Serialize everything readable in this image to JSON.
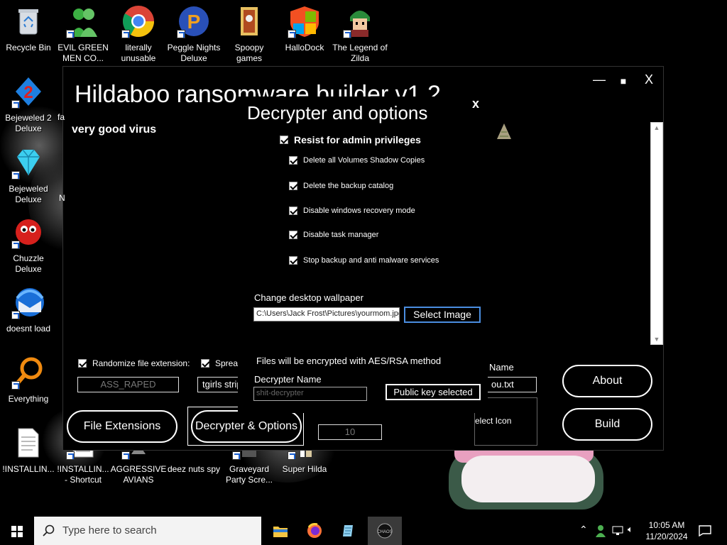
{
  "desktop": {
    "icons": [
      {
        "label": "Recycle Bin",
        "icon": "recycle-bin-icon"
      },
      {
        "label": "EVIL GREEN MEN CO...",
        "icon": "green-men-icon"
      },
      {
        "label": "literally unusable",
        "icon": "chrome-icon"
      },
      {
        "label": "Peggle Nights Deluxe",
        "icon": "peggle-icon"
      },
      {
        "label": "Spoopy games",
        "icon": "folder-icon"
      },
      {
        "label": "HalloDock",
        "icon": "windows-logo-icon"
      },
      {
        "label": "The Legend of Zilda",
        "icon": "zilda-icon"
      },
      {
        "label": "Bejeweled 2 Deluxe",
        "icon": "bejeweled2-icon"
      },
      {
        "label": "Bejeweled Deluxe",
        "icon": "diamond-icon"
      },
      {
        "label": "Chuzzle Deluxe",
        "icon": "chuzzle-icon"
      },
      {
        "label": "doesnt load",
        "icon": "thunderbird-icon"
      },
      {
        "label": "Everything",
        "icon": "everything-search-icon"
      },
      {
        "label": "!INSTALLIN...",
        "icon": "document-icon"
      },
      {
        "label": "!INSTALLIN... - Shortcut",
        "icon": "document-icon"
      },
      {
        "label": "AGGRESSIVE AVIANS",
        "icon": "game-icon"
      },
      {
        "label": "deez nuts spy",
        "icon": "game-icon"
      },
      {
        "label": "Graveyard Party Scre...",
        "icon": "game-icon"
      },
      {
        "label": "Super Hilda",
        "icon": "game-icon"
      }
    ],
    "partial_labels": [
      "fa",
      "N"
    ]
  },
  "app": {
    "title": "Hildaboo ransomware builder v1.2",
    "controls": {
      "minimize": "—",
      "maximize": "■",
      "close": "X"
    },
    "subtitle": "very good virus",
    "randomize_label": "Randomize file extension:",
    "randomize_checked": true,
    "spread_label": "Spread",
    "spread_checked": true,
    "extension_value": "ASS_RAPED",
    "spread_value": "tgirls strip",
    "name_label": "Name",
    "name_value": "ou.txt",
    "icon_box_label": "elect Icon",
    "number_value": "10",
    "buttons": {
      "file_extensions": "File Extensions",
      "decrypter_options": "Decrypter & Options",
      "about": "About",
      "build": "Build"
    }
  },
  "dialog": {
    "title": "Decrypter and options",
    "close": "x",
    "main_option": {
      "label": "Resist for admin privileges",
      "checked": true
    },
    "options": [
      {
        "label": "Delete all Volumes Shadow Copies",
        "checked": true
      },
      {
        "label": "Delete the backup catalog",
        "checked": true
      },
      {
        "label": "Disable windows recovery mode",
        "checked": true
      },
      {
        "label": "Disable task manager",
        "checked": true
      },
      {
        "label": "Stop backup and anti malware services",
        "checked": true
      }
    ],
    "wallpaper_label": "Change desktop wallpaper",
    "wallpaper_path": "C:\\Users\\Jack Frost\\Pictures\\yourmom.jpg",
    "select_image": "Select Image",
    "encryption_note": "Files will be encrypted with AES/RSA method",
    "decrypter_name_label": "Decrypter Name",
    "decrypter_name_value": "shit-decrypter",
    "public_key_button": "Public key selected"
  },
  "taskbar": {
    "search_placeholder": "Type here to search",
    "apps": [
      "file-explorer-icon",
      "firefox-icon",
      "notepad-icon",
      "chaos-icon"
    ],
    "clock": {
      "time": "10:05 AM",
      "date": "11/20/2024"
    }
  }
}
